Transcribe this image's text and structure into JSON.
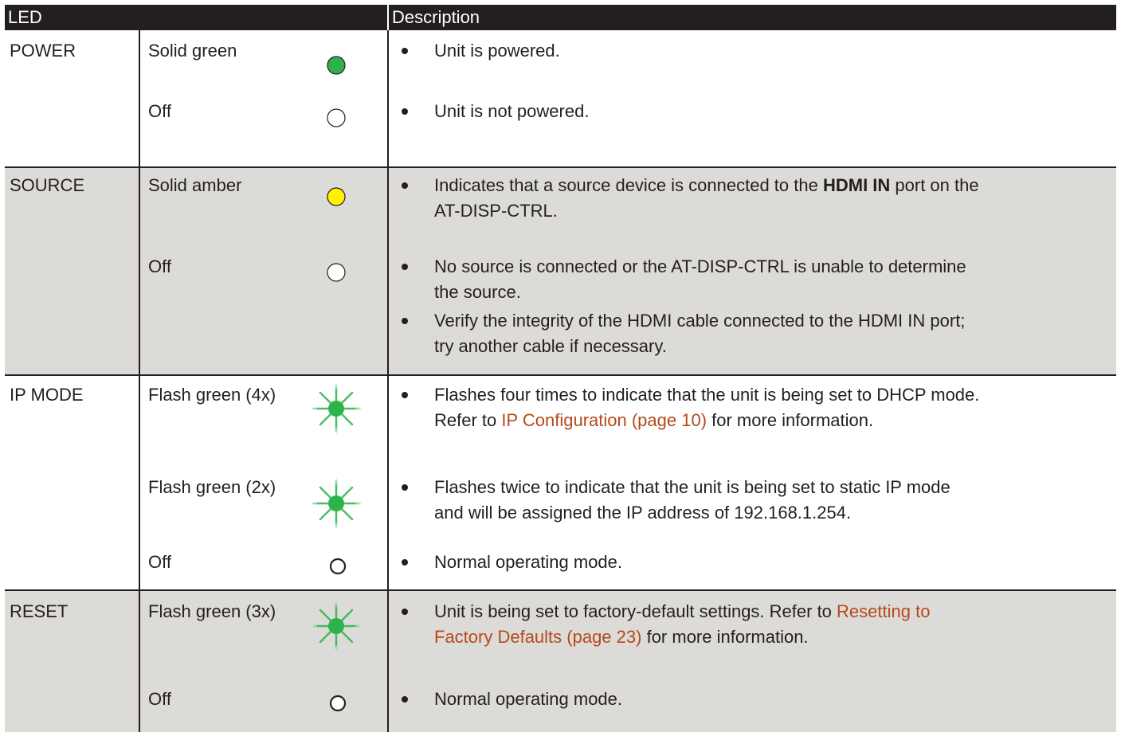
{
  "header": {
    "led": "LED",
    "description": "Description"
  },
  "groups": {
    "power": {
      "name": "POWER",
      "rows": {
        "r0": {
          "state": "Solid green",
          "led_icon": "led-solid-green-icon",
          "desc0": "Unit is powered."
        },
        "r1": {
          "state": "Off",
          "led_icon": "led-off-icon",
          "desc0": "Unit is not powered."
        }
      }
    },
    "source": {
      "name": "SOURCE",
      "rows": {
        "r0": {
          "state": "Solid amber",
          "led_icon": "led-solid-amber-icon",
          "desc0": {
            "l1_pre": "Indicates that a source device is connected to the ",
            "l1_bold": "HDMI IN",
            "l1_post": " port on the",
            "l2": "AT-DISP-CTRL."
          }
        },
        "r1": {
          "state": "Off",
          "led_icon": "led-off-icon",
          "desc0": {
            "l1": "No source is connected or the AT-DISP-CTRL is unable to determine",
            "l2": "the source."
          },
          "desc1": {
            "l1": "Verify the integrity of the HDMI cable connected to the HDMI IN port;",
            "l2": "try another cable if necessary."
          }
        }
      }
    },
    "ipmode": {
      "name": "IP MODE",
      "rows": {
        "r0": {
          "state": "Flash green (4x)",
          "led_icon": "led-flash-green-icon",
          "desc0": {
            "l1": "Flashes four times to indicate that the unit is being set to DHCP mode.",
            "l2_pre": "Refer to ",
            "l2_link": "IP Configuration (page 10)",
            "l2_post": " for more information."
          }
        },
        "r1": {
          "state": "Flash green (2x)",
          "led_icon": "led-flash-green-icon",
          "desc0": {
            "l1": "Flashes twice to indicate that the unit is being set to static IP mode",
            "l2": "and will be assigned the IP address of 192.168.1.254."
          }
        },
        "r2": {
          "state": "Off",
          "led_icon": "led-off-icon",
          "desc0": "Normal operating mode."
        }
      }
    },
    "reset": {
      "name": "RESET",
      "rows": {
        "r0": {
          "state": "Flash green (3x)",
          "led_icon": "led-flash-green-icon",
          "desc0": {
            "l1_pre": "Unit is being set to factory-default settings.  Refer to ",
            "l1_link": "Resetting to",
            "l2_link": "Factory Defaults (page 23)",
            "l2_post": " for more information."
          }
        },
        "r1": {
          "state": "Off",
          "led_icon": "led-off-icon",
          "desc0": "Normal operating mode."
        }
      }
    }
  },
  "colors": {
    "header_bg": "#231f20",
    "shade_bg": "#dddbd8",
    "text": "#231f20",
    "link": "#b4491c",
    "led_green": "#2db34a",
    "led_amber": "#fff200"
  }
}
